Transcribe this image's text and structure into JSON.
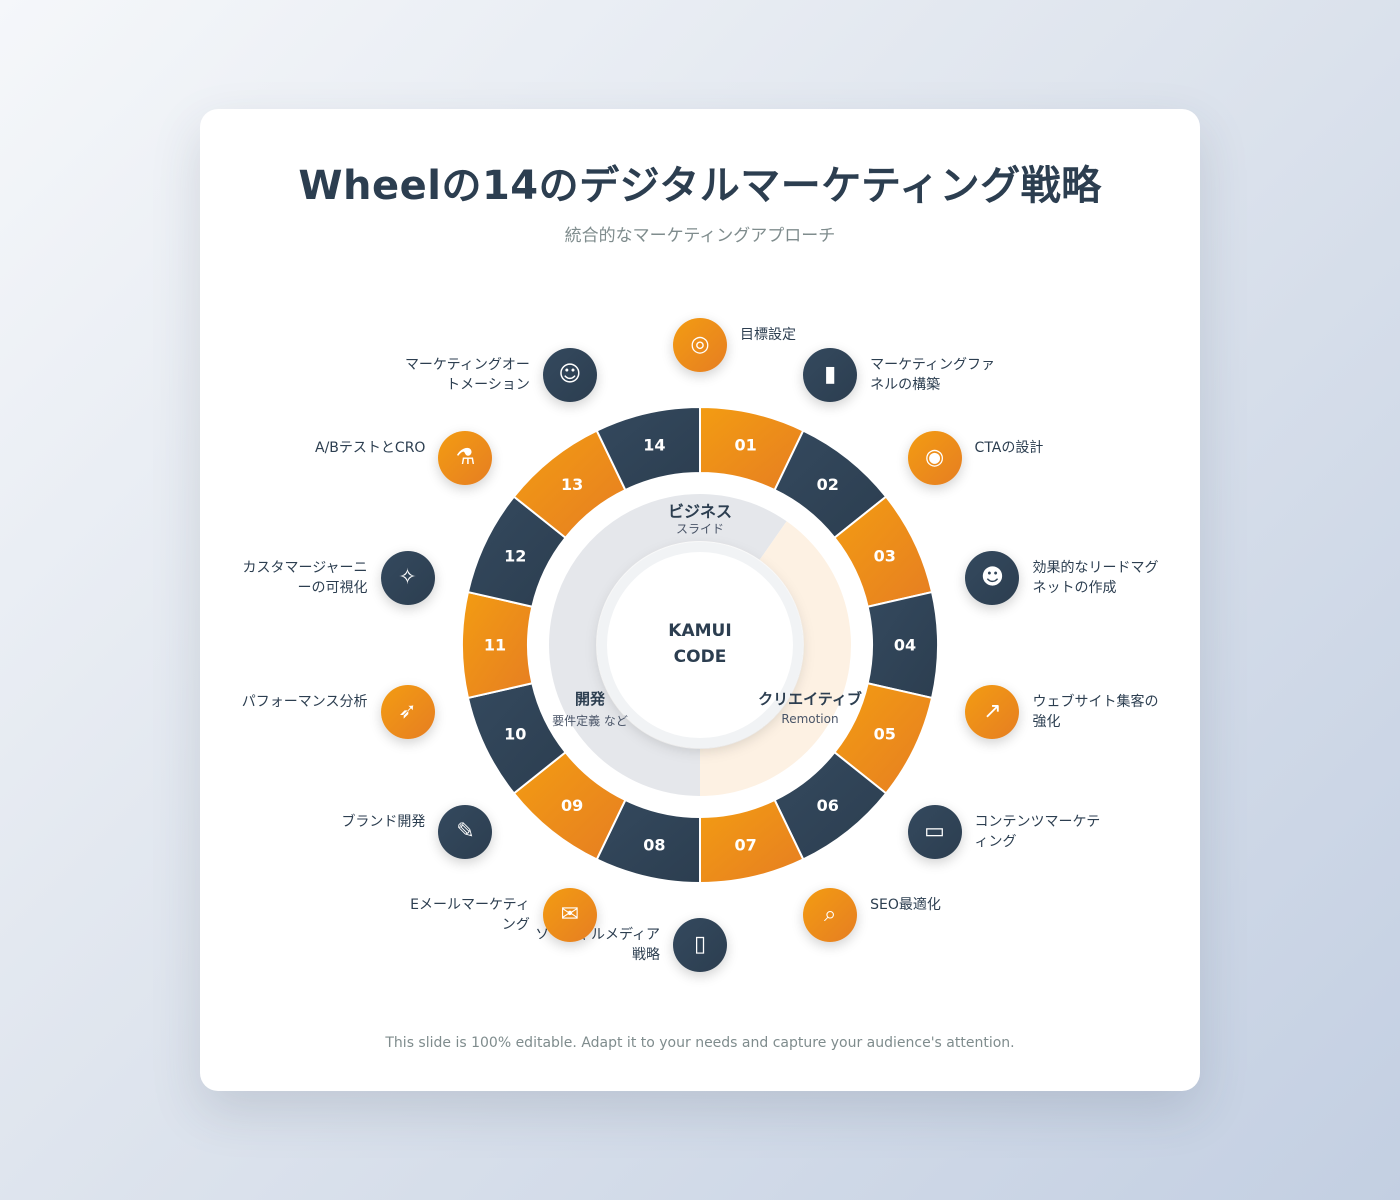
{
  "title": "Wheelの14のデジタルマーケティング戦略",
  "subtitle": "統合的なマーケティングアプローチ",
  "footer": "This slide is 100% editable. Adapt it to your needs and capture your audience's attention.",
  "colors": {
    "orange": "#f39c12",
    "dark": "#2c3e50"
  },
  "center": {
    "label_line1": "KAMUI",
    "label_line2": "CODE",
    "sections": [
      {
        "name": "ビジネス",
        "sub": "スライド"
      },
      {
        "name": "クリエイティブ",
        "sub": "Remotion"
      },
      {
        "name": "開発",
        "sub": "要件定義 など"
      }
    ]
  },
  "segments": [
    {
      "number": "01",
      "color": "orange"
    },
    {
      "number": "02",
      "color": "dark"
    },
    {
      "number": "03",
      "color": "orange"
    },
    {
      "number": "04",
      "color": "dark"
    },
    {
      "number": "05",
      "color": "orange"
    },
    {
      "number": "06",
      "color": "dark"
    },
    {
      "number": "07",
      "color": "orange"
    },
    {
      "number": "08",
      "color": "dark"
    },
    {
      "number": "09",
      "color": "orange"
    },
    {
      "number": "10",
      "color": "dark"
    },
    {
      "number": "11",
      "color": "orange"
    },
    {
      "number": "12",
      "color": "dark"
    },
    {
      "number": "13",
      "color": "orange"
    },
    {
      "number": "14",
      "color": "dark"
    }
  ],
  "steps": [
    {
      "label": "目標設定",
      "icon": "target-icon",
      "color": "orange"
    },
    {
      "label": "マーケティングファネルの構築",
      "icon": "bar-chart-icon",
      "color": "dark"
    },
    {
      "label": "CTAの設計",
      "icon": "dart-icon",
      "color": "orange"
    },
    {
      "label": "効果的なリードマグネットの作成",
      "icon": "people-icon",
      "color": "dark"
    },
    {
      "label": "ウェブサイト集客の強化",
      "icon": "trend-up-icon",
      "color": "orange"
    },
    {
      "label": "コンテンツマーケティング",
      "icon": "laptop-icon",
      "color": "dark"
    },
    {
      "label": "SEO最適化",
      "icon": "search-icon",
      "color": "orange"
    },
    {
      "label": "ソーシャルメディア戦略",
      "icon": "phone-icon",
      "color": "dark"
    },
    {
      "label": "Eメールマーケティング",
      "icon": "mail-icon",
      "color": "orange"
    },
    {
      "label": "ブランド開発",
      "icon": "palette-icon",
      "color": "dark"
    },
    {
      "label": "パフォーマンス分析",
      "icon": "rocket-icon",
      "color": "orange"
    },
    {
      "label": "カスタマージャーニーの可視化",
      "icon": "compass-icon",
      "color": "dark"
    },
    {
      "label": "A/BテストとCRO",
      "icon": "test-tube-icon",
      "color": "orange"
    },
    {
      "label": "マーケティングオートメーション",
      "icon": "robot-icon",
      "color": "dark"
    }
  ]
}
